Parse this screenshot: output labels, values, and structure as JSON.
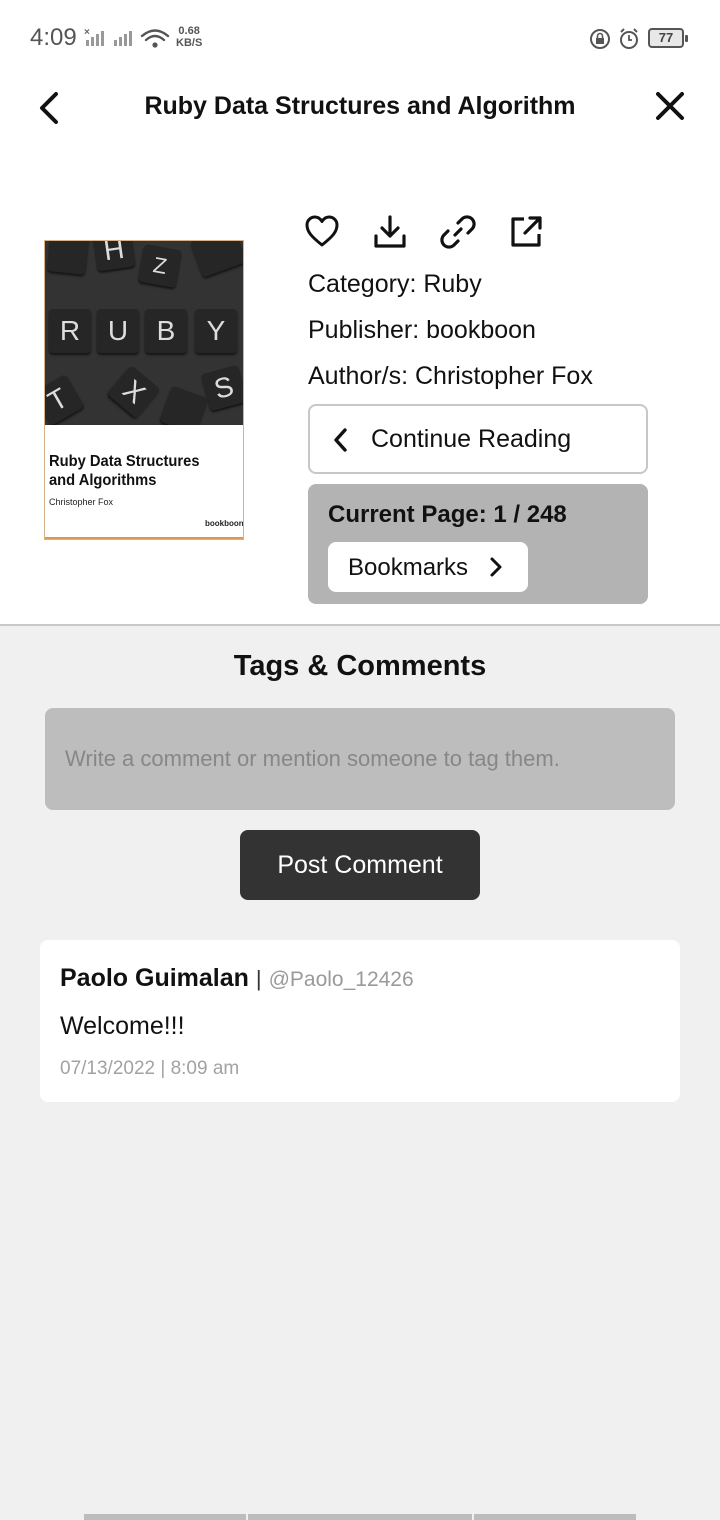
{
  "status_bar": {
    "time": "4:09",
    "speed_value": "0.68",
    "speed_unit": "KB/S",
    "battery": "77"
  },
  "header": {
    "title": "Ruby Data Structures and Algorithm"
  },
  "book": {
    "cover": {
      "tiles": [
        "H",
        "Z",
        "R",
        "U",
        "B",
        "Y",
        "T",
        "X",
        "S"
      ],
      "title": "Ruby Data Structures and Algorithms",
      "author": "Christopher Fox",
      "publisher": "bookboon"
    },
    "category": "Category: Ruby",
    "publisher": "Publisher: bookboon",
    "author": "Author/s: Christopher Fox",
    "continue_label": "Continue Reading",
    "current_page": "Current Page: 1 / 248",
    "bookmarks_label": "Bookmarks"
  },
  "actions": {
    "icons": [
      "heart-icon",
      "download-icon",
      "link-icon",
      "external-link-icon"
    ]
  },
  "comments": {
    "section_title": "Tags & Comments",
    "input_placeholder": "Write a comment or mention someone to tag them.",
    "post_label": "Post Comment",
    "items": [
      {
        "name": "Paolo Guimalan",
        "separator": "|",
        "handle": "@Paolo_12426",
        "text": "Welcome!!!",
        "timestamp": "07/13/2022 | 8:09 am"
      }
    ]
  }
}
